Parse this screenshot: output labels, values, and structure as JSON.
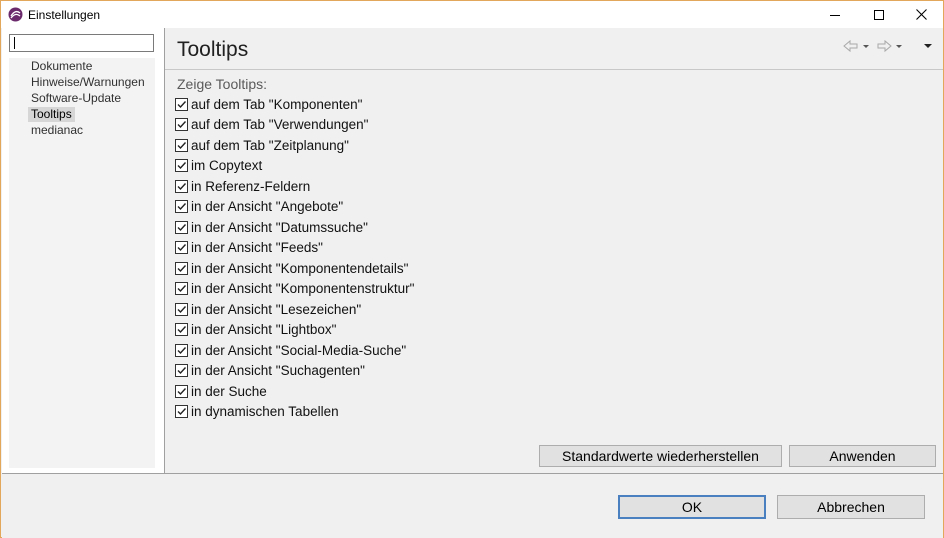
{
  "window": {
    "title": "Einstellungen"
  },
  "sidebar": {
    "filter_value": "",
    "items": [
      {
        "label": "Dokumente",
        "selected": false
      },
      {
        "label": "Hinweise/Warnungen",
        "selected": false
      },
      {
        "label": "Software-Update",
        "selected": false
      },
      {
        "label": "Tooltips",
        "selected": true
      },
      {
        "label": "medianac",
        "selected": false
      }
    ]
  },
  "page": {
    "title": "Tooltips",
    "group_label": "Zeige Tooltips:",
    "options": [
      {
        "label": "auf dem Tab \"Komponenten\"",
        "checked": true
      },
      {
        "label": "auf dem Tab \"Verwendungen\"",
        "checked": true
      },
      {
        "label": "auf dem Tab \"Zeitplanung\"",
        "checked": true
      },
      {
        "label": "im Copytext",
        "checked": true
      },
      {
        "label": "in Referenz-Feldern",
        "checked": true
      },
      {
        "label": "in der Ansicht \"Angebote\"",
        "checked": true
      },
      {
        "label": "in der Ansicht \"Datumssuche\"",
        "checked": true
      },
      {
        "label": "in der Ansicht \"Feeds\"",
        "checked": true
      },
      {
        "label": "in der Ansicht \"Komponentendetails\"",
        "checked": true
      },
      {
        "label": "in der Ansicht \"Komponentenstruktur\"",
        "checked": true
      },
      {
        "label": "in der Ansicht \"Lesezeichen\"",
        "checked": true
      },
      {
        "label": "in der Ansicht \"Lightbox\"",
        "checked": true
      },
      {
        "label": "in der Ansicht \"Social-Media-Suche\"",
        "checked": true
      },
      {
        "label": "in der Ansicht \"Suchagenten\"",
        "checked": true
      },
      {
        "label": "in der Suche",
        "checked": true
      },
      {
        "label": "in dynamischen Tabellen",
        "checked": true
      }
    ],
    "restore_defaults_label": "Standardwerte wiederherstellen",
    "apply_label": "Anwenden"
  },
  "dialog": {
    "ok_label": "OK",
    "cancel_label": "Abbrechen"
  },
  "icons": {
    "app": "app-logo-icon",
    "minimize": "minimize-icon",
    "maximize": "maximize-icon",
    "close": "close-icon",
    "back": "back-arrow-icon",
    "forward": "forward-arrow-icon",
    "menu": "view-menu-icon"
  },
  "colors": {
    "window_border": "#e2a75a",
    "default_button_border": "#4a7fc0",
    "app_icon": "#6b2a6b"
  }
}
